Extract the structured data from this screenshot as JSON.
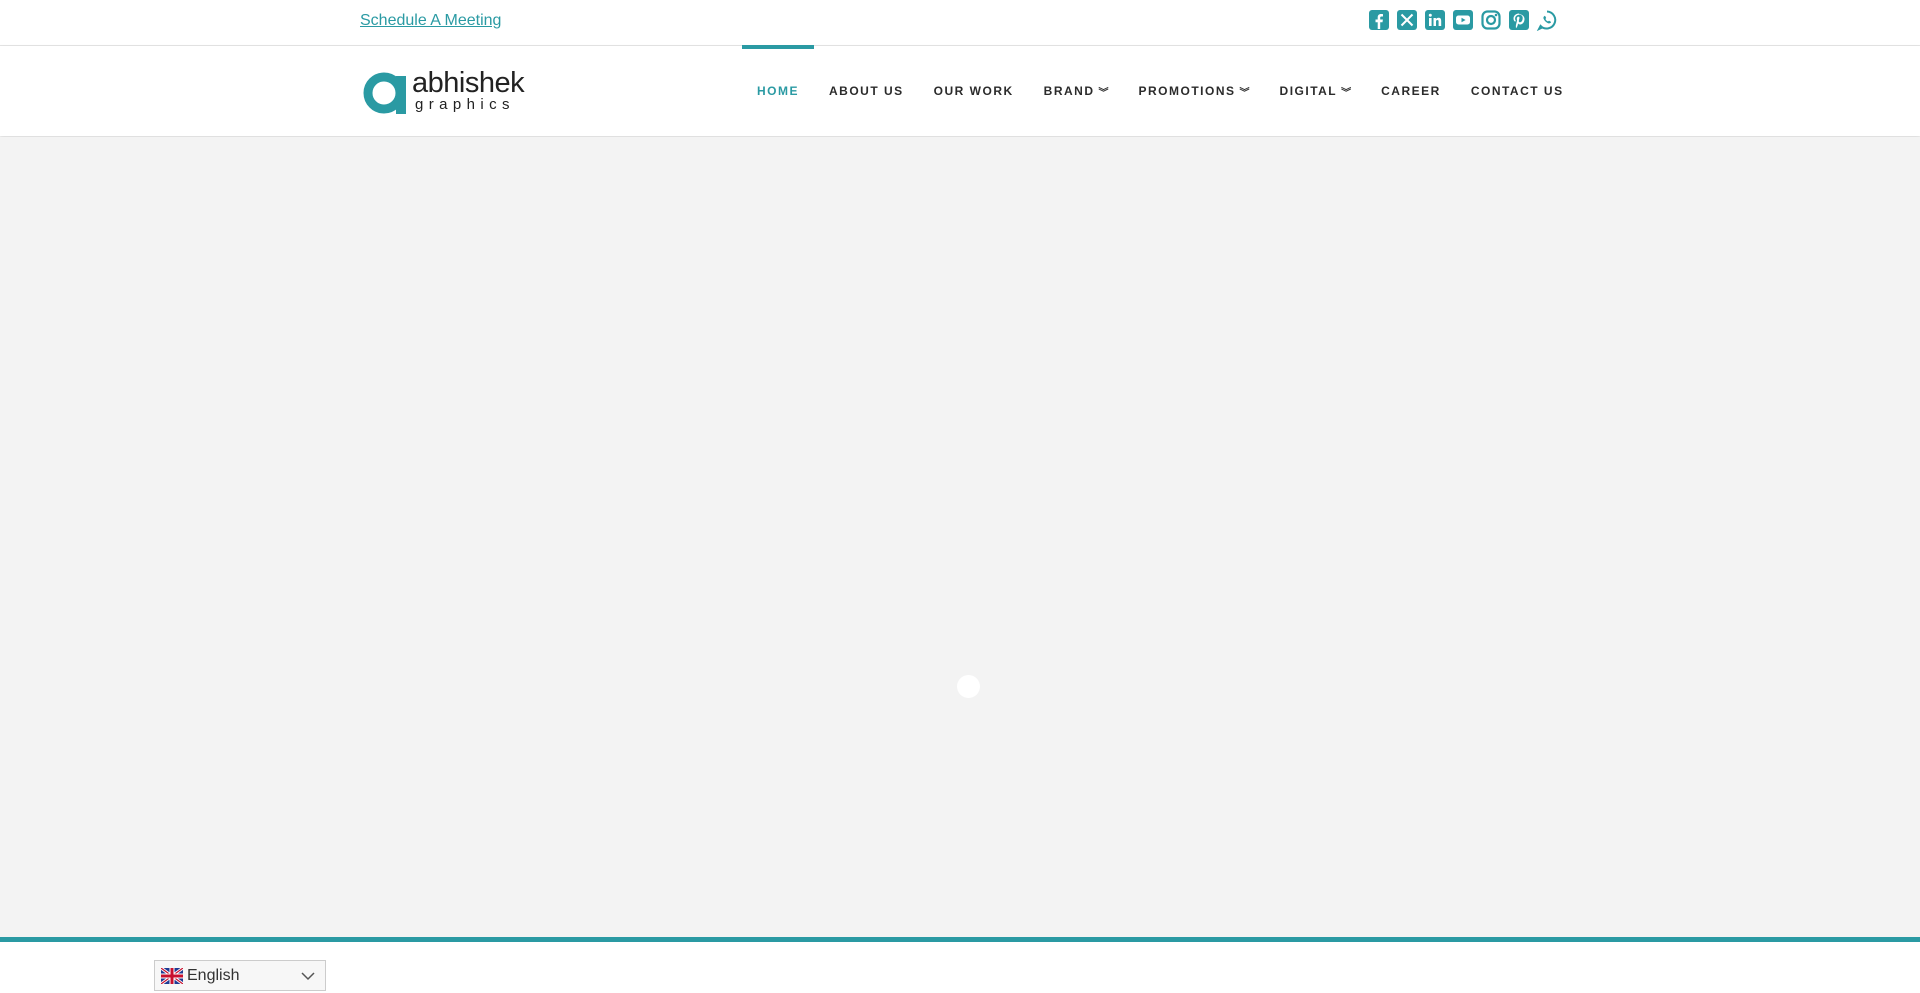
{
  "topbar": {
    "schedule_label": "Schedule A Meeting",
    "social_icons": [
      "facebook-icon",
      "x-twitter-icon",
      "linkedin-icon",
      "youtube-icon",
      "instagram-icon",
      "pinterest-icon",
      "whatsapp-icon"
    ]
  },
  "logo": {
    "word": "abhishek",
    "sub": "graphics"
  },
  "nav": {
    "items": [
      {
        "label": "HOME",
        "active": true
      },
      {
        "label": "ABOUT US"
      },
      {
        "label": "OUR WORK"
      },
      {
        "label": "BRAND",
        "dropdown": true
      },
      {
        "label": "PROMOTIONS",
        "dropdown": true
      },
      {
        "label": "DIGITAL",
        "dropdown": true
      },
      {
        "label": "CAREER"
      },
      {
        "label": "CONTACT US"
      }
    ]
  },
  "language": {
    "selected": "English",
    "icons": [
      "uk-flag-icon",
      "chevron-down-icon"
    ]
  },
  "colors": {
    "accent": "#2a9aa3",
    "background": "#f3f3f3",
    "text_dark": "#2b2b2b"
  }
}
